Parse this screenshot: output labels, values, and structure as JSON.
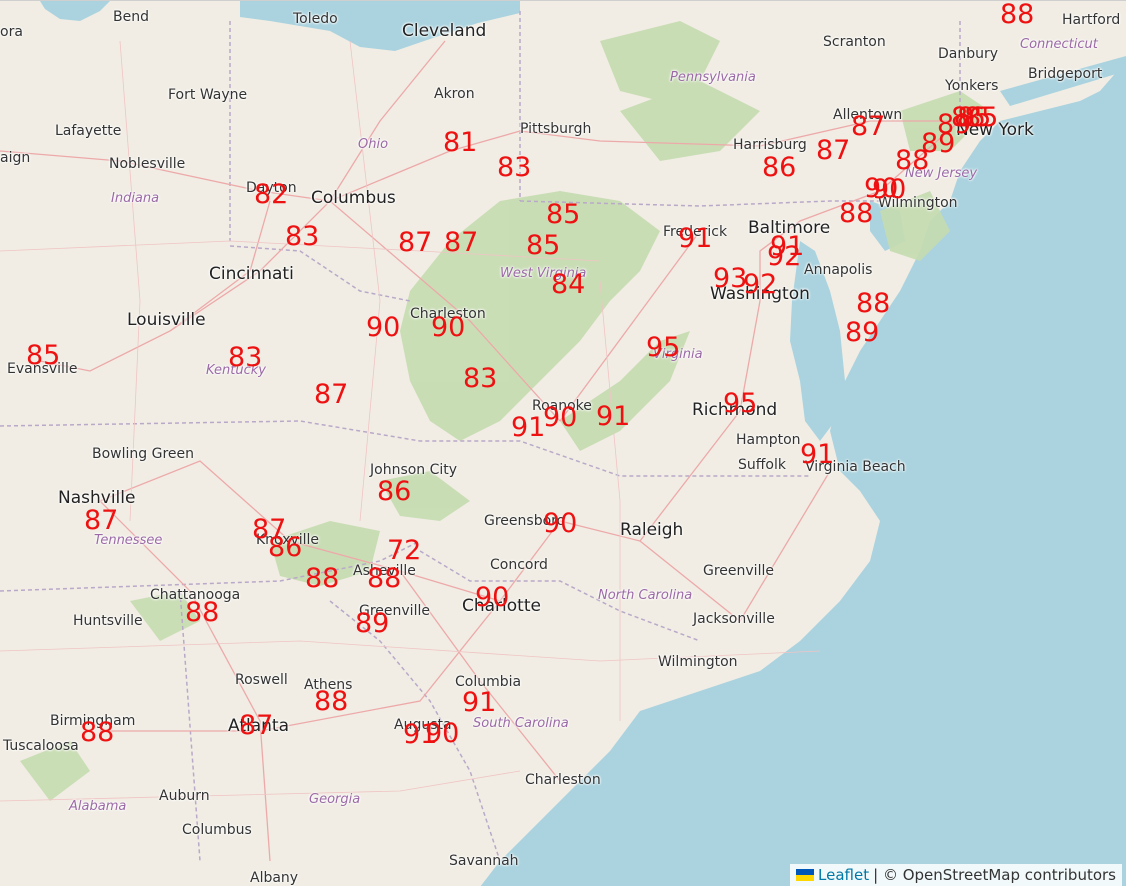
{
  "map": {
    "colors": {
      "land": "#f1ede4",
      "water": "#aad3df",
      "forest": "#c5dcb0",
      "road": "#eda9a9",
      "state_border": "#b9a9c9",
      "temp": "#ee1111"
    },
    "places": [
      {
        "name": "Bend",
        "kind": "city"
      },
      {
        "name": "Toledo",
        "kind": "city"
      },
      {
        "name": "Cleveland",
        "kind": "big"
      },
      {
        "name": "Scranton",
        "kind": "city"
      },
      {
        "name": "Hartford",
        "kind": "city"
      },
      {
        "name": "Danbury",
        "kind": "city"
      },
      {
        "name": "Connecticut",
        "kind": "state"
      },
      {
        "name": "Pennsylvania",
        "kind": "state"
      },
      {
        "name": "Yonkers",
        "kind": "city"
      },
      {
        "name": "Bridgeport",
        "kind": "city"
      },
      {
        "name": "Fort Wayne",
        "kind": "city"
      },
      {
        "name": "Akron",
        "kind": "city"
      },
      {
        "name": "Lafayette",
        "kind": "city"
      },
      {
        "name": "Pittsburgh",
        "kind": "city"
      },
      {
        "name": "Allentown",
        "kind": "city"
      },
      {
        "name": "New York",
        "kind": "big"
      },
      {
        "name": "Ohio",
        "kind": "state"
      },
      {
        "name": "Harrisburg",
        "kind": "city"
      },
      {
        "name": "Noblesville",
        "kind": "city"
      },
      {
        "name": "Dayton",
        "kind": "city"
      },
      {
        "name": "Columbus",
        "kind": "big"
      },
      {
        "name": "New Jersey",
        "kind": "state"
      },
      {
        "name": "Indiana",
        "kind": "state"
      },
      {
        "name": "Wilmington",
        "kind": "city"
      },
      {
        "name": "Baltimore",
        "kind": "big"
      },
      {
        "name": "Frederick",
        "kind": "city"
      },
      {
        "name": "Cincinnati",
        "kind": "big"
      },
      {
        "name": "West Virginia",
        "kind": "state"
      },
      {
        "name": "Annapolis",
        "kind": "city"
      },
      {
        "name": "Washington",
        "kind": "big"
      },
      {
        "name": "Charleston",
        "kind": "city"
      },
      {
        "name": "Louisville",
        "kind": "big"
      },
      {
        "name": "Evansville",
        "kind": "city"
      },
      {
        "name": "Kentucky",
        "kind": "state"
      },
      {
        "name": "Virginia",
        "kind": "state"
      },
      {
        "name": "Roanoke",
        "kind": "city"
      },
      {
        "name": "Richmond",
        "kind": "big"
      },
      {
        "name": "Hampton",
        "kind": "city"
      },
      {
        "name": "Suffolk",
        "kind": "city"
      },
      {
        "name": "Virginia Beach",
        "kind": "city"
      },
      {
        "name": "Bowling Green",
        "kind": "city"
      },
      {
        "name": "Johnson City",
        "kind": "city"
      },
      {
        "name": "Nashville",
        "kind": "big"
      },
      {
        "name": "Greensboro",
        "kind": "city"
      },
      {
        "name": "Raleigh",
        "kind": "big"
      },
      {
        "name": "Tennessee",
        "kind": "state"
      },
      {
        "name": "Knoxville",
        "kind": "city"
      },
      {
        "name": "Concord",
        "kind": "city"
      },
      {
        "name": "Asheville",
        "kind": "city"
      },
      {
        "name": "Greenville",
        "kind": "city"
      },
      {
        "name": "Chattanooga",
        "kind": "city"
      },
      {
        "name": "Charlotte",
        "kind": "big"
      },
      {
        "name": "North Carolina",
        "kind": "state"
      },
      {
        "name": "Jacksonville",
        "kind": "city"
      },
      {
        "name": "Huntsville",
        "kind": "city"
      },
      {
        "name": "Greenville",
        "kind": "city"
      },
      {
        "name": "Wilmington",
        "kind": "city"
      },
      {
        "name": "Roswell",
        "kind": "city"
      },
      {
        "name": "Athens",
        "kind": "city"
      },
      {
        "name": "Columbia",
        "kind": "city"
      },
      {
        "name": "Birmingham",
        "kind": "city"
      },
      {
        "name": "Atlanta",
        "kind": "big"
      },
      {
        "name": "Augusta",
        "kind": "city"
      },
      {
        "name": "South Carolina",
        "kind": "state"
      },
      {
        "name": "Tuscaloosa",
        "kind": "city"
      },
      {
        "name": "Charleston",
        "kind": "city"
      },
      {
        "name": "Auburn",
        "kind": "city"
      },
      {
        "name": "Alabama",
        "kind": "state"
      },
      {
        "name": "Georgia",
        "kind": "state"
      },
      {
        "name": "Columbus",
        "kind": "city"
      },
      {
        "name": "Savannah",
        "kind": "city"
      },
      {
        "name": "Albany",
        "kind": "city"
      },
      {
        "name": "aign",
        "kind": "city"
      },
      {
        "name": "ora",
        "kind": "city"
      }
    ],
    "temperatures": [
      "81",
      "83",
      "82",
      "83",
      "87",
      "87",
      "85",
      "85",
      "84",
      "90",
      "90",
      "83",
      "87",
      "85",
      "83",
      "87",
      "90",
      "91",
      "91",
      "86",
      "72",
      "87",
      "86",
      "88",
      "88",
      "88",
      "89",
      "90",
      "90",
      "91",
      "91",
      "90",
      "88",
      "87",
      "88",
      "95",
      "91",
      "95",
      "93",
      "92",
      "91",
      "92",
      "89",
      "91",
      "86",
      "87",
      "87",
      "88",
      "89",
      "90",
      "90",
      "88",
      "88",
      "89",
      "86",
      "85",
      "85",
      "88"
    ]
  },
  "attribution": {
    "leaflet": "Leaflet",
    "rest": "| © OpenStreetMap contributors"
  }
}
